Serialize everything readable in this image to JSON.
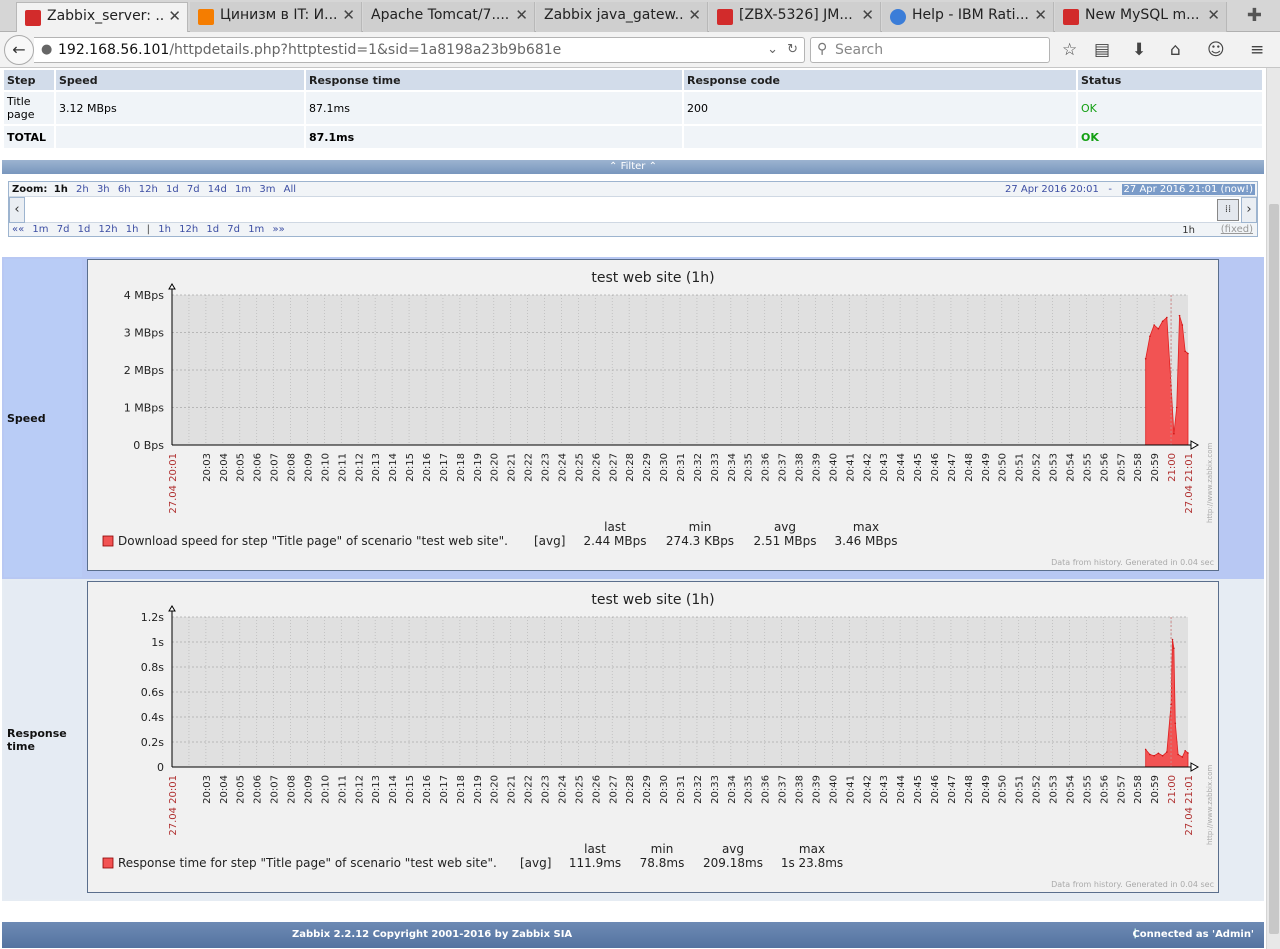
{
  "browser": {
    "tabs": [
      {
        "title": "Zabbix_server: ...",
        "icon": "zabbix-icon",
        "color": "#d22b2b",
        "active": true
      },
      {
        "title": "Цинизм в IT: И...",
        "icon": "blogger-icon",
        "color": "#f57d00"
      },
      {
        "title": "Apache Tomcat/7....",
        "icon": "none"
      },
      {
        "title": "Zabbix java_gatew...",
        "icon": "none"
      },
      {
        "title": "[ZBX-5326] JM...",
        "icon": "zabbix-icon",
        "color": "#d22b2b"
      },
      {
        "title": "Help - IBM Rati...",
        "icon": "globe-icon",
        "color": "#3b7dd8"
      },
      {
        "title": "New MySQL m...",
        "icon": "zabbix-icon",
        "color": "#d22b2b"
      }
    ],
    "url_host": "192.168.56.101",
    "url_path": "/httpdetails.php?httptestid=1&sid=1a8198a23b9b681e",
    "search_placeholder": "Search"
  },
  "steps_table": {
    "headers": [
      "Step",
      "Speed",
      "Response time",
      "Response code",
      "Status"
    ],
    "rows": [
      {
        "step": "Title page",
        "speed": "3.12 MBps",
        "response_time": "87.1ms",
        "response_code": "200",
        "status": "OK"
      },
      {
        "step": "TOTAL",
        "speed": "",
        "response_time": "87.1ms",
        "response_code": "",
        "status": "OK"
      }
    ]
  },
  "filter": {
    "label": "Filter",
    "zoom_label": "Zoom:",
    "zoom_options": [
      "1h",
      "2h",
      "3h",
      "6h",
      "12h",
      "1d",
      "7d",
      "14d",
      "1m",
      "3m",
      "All"
    ],
    "period_from": "27 Apr 2016 20:01",
    "period_sep": "-",
    "period_to": "27 Apr 2016 21:01 (now!)",
    "nav_back": [
      "«« ",
      "1m",
      "7d",
      "1d",
      "12h",
      "1h"
    ],
    "nav_sep": "|",
    "nav_fwd": [
      "1h",
      "12h",
      "1d",
      "7d",
      "1m",
      " »»"
    ],
    "period_length": "1h",
    "fixed_label": "(fixed)"
  },
  "x_axis": {
    "start_label": "27.04 20:01",
    "end_label": "27.04 21:01",
    "highlight_label": "21:00",
    "ticks": [
      "20:03",
      "20:04",
      "20:05",
      "20:06",
      "20:07",
      "20:08",
      "20:09",
      "20:10",
      "20:11",
      "20:12",
      "20:13",
      "20:14",
      "20:15",
      "20:16",
      "20:17",
      "20:18",
      "20:19",
      "20:20",
      "20:21",
      "20:22",
      "20:23",
      "20:24",
      "20:25",
      "20:26",
      "20:27",
      "20:28",
      "20:29",
      "20:30",
      "20:31",
      "20:32",
      "20:33",
      "20:34",
      "20:35",
      "20:36",
      "20:37",
      "20:38",
      "20:39",
      "20:40",
      "20:41",
      "20:42",
      "20:43",
      "20:44",
      "20:45",
      "20:46",
      "20:47",
      "20:48",
      "20:49",
      "20:50",
      "20:51",
      "20:52",
      "20:53",
      "20:54",
      "20:55",
      "20:56",
      "20:57",
      "20:58",
      "20:59"
    ],
    "side_watermark": "http://www.zabbix.com"
  },
  "graphs": [
    {
      "section_label": "Speed",
      "title": "test web site (1h)",
      "y_ticks": [
        "0 Bps",
        "1 MBps",
        "2 MBps",
        "3 MBps",
        "4 MBps"
      ],
      "legend": {
        "color": "#f25353",
        "item": "Download speed for step \"Title page\" of scenario \"test web site\".",
        "func": "[avg]",
        "cols": [
          "last",
          "min",
          "avg",
          "max"
        ],
        "values": [
          "2.44 MBps",
          "274.3 KBps",
          "2.51 MBps",
          "3.46 MBps"
        ]
      },
      "footer_note": "Data from history. Generated in 0.04 sec"
    },
    {
      "section_label": "Response time",
      "title": "test web site (1h)",
      "y_ticks": [
        "0",
        "0.2s",
        "0.4s",
        "0.6s",
        "0.8s",
        "1s",
        "1.2s"
      ],
      "legend": {
        "color": "#f25353",
        "item": "Response time for step \"Title page\" of scenario \"test web site\".",
        "func": "[avg]",
        "cols": [
          "last",
          "min",
          "avg",
          "max"
        ],
        "values": [
          "111.9ms",
          "78.8ms",
          "209.18ms",
          "1s 23.8ms"
        ]
      },
      "footer_note": "Data from history. Generated in 0.04 sec"
    }
  ],
  "chart_data": [
    {
      "type": "area",
      "title": "test web site (1h)",
      "ylabel": "Speed",
      "ylim": [
        0,
        4
      ],
      "y_unit": "MBps",
      "x": [
        "20:58:30",
        "20:58:45",
        "20:59:00",
        "20:59:15",
        "20:59:30",
        "20:59:45",
        "21:00:00",
        "21:00:10",
        "21:00:20",
        "21:00:30",
        "21:00:40",
        "21:00:50",
        "21:01:00"
      ],
      "series": [
        {
          "name": "Download speed for step \"Title page\" of scenario \"test web site\".",
          "values": [
            2.3,
            2.9,
            3.2,
            3.1,
            3.3,
            3.4,
            1.6,
            0.3,
            1.0,
            3.45,
            3.2,
            2.5,
            2.44
          ]
        }
      ]
    },
    {
      "type": "area",
      "title": "test web site (1h)",
      "ylabel": "Response time",
      "ylim": [
        0,
        1.2
      ],
      "y_unit": "s",
      "x": [
        "20:58:30",
        "20:58:45",
        "20:59:00",
        "20:59:15",
        "20:59:30",
        "20:59:45",
        "21:00:00",
        "21:00:05",
        "21:00:10",
        "21:00:15",
        "21:00:25",
        "21:00:40",
        "21:00:50",
        "21:01:00"
      ],
      "series": [
        {
          "name": "Response time for step \"Title page\" of scenario \"test web site\".",
          "values": [
            0.14,
            0.1,
            0.09,
            0.11,
            0.09,
            0.12,
            0.5,
            1.02,
            0.95,
            0.35,
            0.1,
            0.08,
            0.13,
            0.112
          ]
        }
      ]
    }
  ],
  "footer": {
    "copyright": "Zabbix 2.2.12 Copyright 2001-2016 by Zabbix SIA",
    "separator": "|",
    "connected": "Connected as 'Admin'"
  }
}
